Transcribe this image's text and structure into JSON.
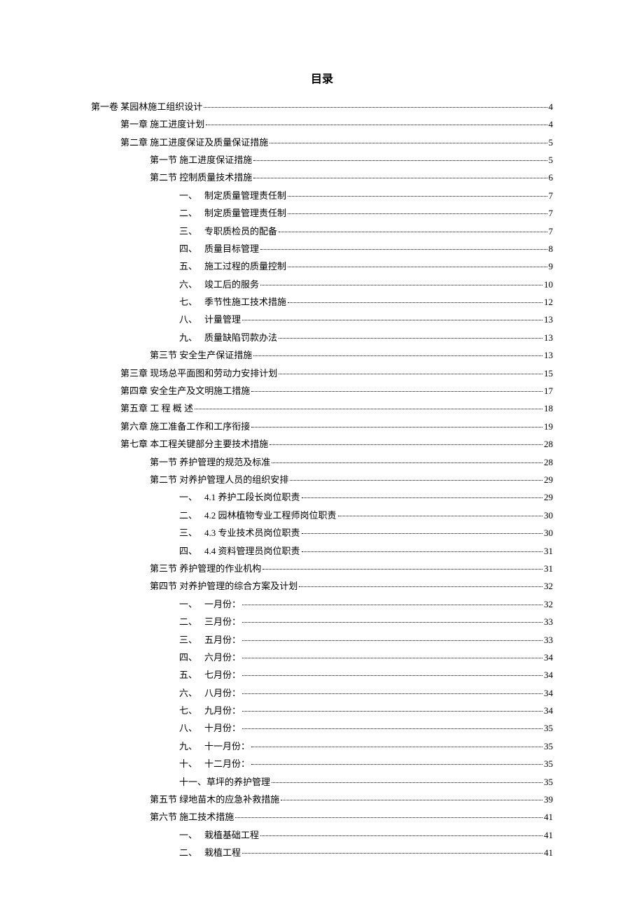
{
  "title": "目录",
  "entries": [
    {
      "level": 1,
      "num": "",
      "text": "第一卷 某园林施工组织设计",
      "page": "4"
    },
    {
      "level": 2,
      "num": "",
      "text": "第一章 施工进度计划",
      "page": "4"
    },
    {
      "level": 2,
      "num": "",
      "text": "第二章 施工进度保证及质量保证措施",
      "page": "5"
    },
    {
      "level": 3,
      "num": "",
      "text": "第一节 施工进度保证措施",
      "page": "5"
    },
    {
      "level": 3,
      "num": "",
      "text": "第二节 控制质量技术措施",
      "page": "6"
    },
    {
      "level": 4,
      "num": "一、",
      "text": "制定质量管理责任制",
      "page": "7"
    },
    {
      "level": 4,
      "num": "二、",
      "text": "制定质量管理责任制",
      "page": "7"
    },
    {
      "level": 4,
      "num": "三、",
      "text": "专职质检员的配备",
      "page": "7"
    },
    {
      "level": 4,
      "num": "四、",
      "text": "质量目标管理",
      "page": "8"
    },
    {
      "level": 4,
      "num": "五、",
      "text": "施工过程的质量控制",
      "page": "9"
    },
    {
      "level": 4,
      "num": "六、",
      "text": "竣工后的服务",
      "page": "10"
    },
    {
      "level": 4,
      "num": "七、",
      "text": "季节性施工技术措施",
      "page": "12"
    },
    {
      "level": 4,
      "num": "八、",
      "text": "计量管理",
      "page": "13"
    },
    {
      "level": 4,
      "num": "九、",
      "text": "质量缺陷罚款办法",
      "page": "13"
    },
    {
      "level": 3,
      "num": "",
      "text": "第三节 安全生产保证措施",
      "page": "13"
    },
    {
      "level": 2,
      "num": "",
      "text": "第三章 现场总平面图和劳动力安排计划",
      "page": "15"
    },
    {
      "level": 2,
      "num": "",
      "text": "第四章 安全生产及文明施工措施",
      "page": "17"
    },
    {
      "level": 2,
      "num": "",
      "text": "第五章 工 程 概 述",
      "page": "18"
    },
    {
      "level": 2,
      "num": "",
      "text": "第六章 施工准备工作和工序衔接",
      "page": "19"
    },
    {
      "level": 2,
      "num": "",
      "text": "第七章 本工程关键部分主要技术措施",
      "page": "28"
    },
    {
      "level": 3,
      "num": "",
      "text": "第一节 养护管理的规范及标准",
      "page": "28"
    },
    {
      "level": 3,
      "num": "",
      "text": "第二节 对养护管理人员的组织安排",
      "page": "29"
    },
    {
      "level": 4,
      "num": "一、",
      "text": "4.1 养护工段长岗位职责",
      "page": "29"
    },
    {
      "level": 4,
      "num": "二、",
      "text": "4.2 园林植物专业工程师岗位职责",
      "page": "30"
    },
    {
      "level": 4,
      "num": "三、",
      "text": "4.3 专业技术员岗位职责",
      "page": "30"
    },
    {
      "level": 4,
      "num": "四、",
      "text": "4.4 资料管理员岗位职责",
      "page": "31"
    },
    {
      "level": 3,
      "num": "",
      "text": "第三节 养护管理的作业机构",
      "page": "31"
    },
    {
      "level": 3,
      "num": "",
      "text": "第四节 对养护管理的综合方案及计划",
      "page": "32"
    },
    {
      "level": 4,
      "num": "一、",
      "text": "一月份：",
      "page": "32"
    },
    {
      "level": 4,
      "num": "二、",
      "text": "三月份：",
      "page": "33"
    },
    {
      "level": 4,
      "num": "三、",
      "text": "五月份：",
      "page": "33"
    },
    {
      "level": 4,
      "num": "四、",
      "text": "六月份：",
      "page": "34"
    },
    {
      "level": 4,
      "num": "五、",
      "text": "七月份：",
      "page": "34"
    },
    {
      "level": 4,
      "num": "六、",
      "text": "八月份：",
      "page": "34"
    },
    {
      "level": 4,
      "num": "七、",
      "text": "九月份：",
      "page": "34"
    },
    {
      "level": 4,
      "num": "八、",
      "text": "十月份：",
      "page": "35"
    },
    {
      "level": 4,
      "num": "九、",
      "text": "十一月份：",
      "page": "35"
    },
    {
      "level": 4,
      "num": "十、",
      "text": "十二月份：",
      "page": "35"
    },
    {
      "level": 4,
      "num": "十一、",
      "text": "草坪的养护管理",
      "page": "35"
    },
    {
      "level": 3,
      "num": "",
      "text": "第五节 绿地苗木的应急补救措施",
      "page": "39"
    },
    {
      "level": 3,
      "num": "",
      "text": "第六节 施工技术措施",
      "page": "41"
    },
    {
      "level": 4,
      "num": "一、",
      "text": "栽植基础工程",
      "page": "41"
    },
    {
      "level": 4,
      "num": "二、",
      "text": "栽植工程",
      "page": "41"
    }
  ]
}
